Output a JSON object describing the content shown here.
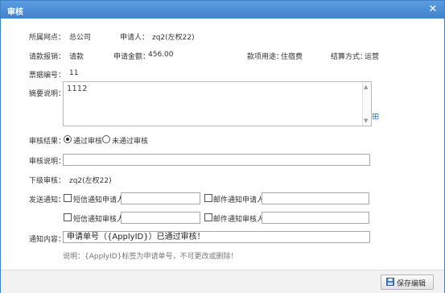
{
  "dialog": {
    "title": "审核",
    "close_glyph": "✕"
  },
  "info": {
    "branch_label": "所属网点：",
    "branch_value": "总公司",
    "applicant_label": "申请人：",
    "applicant_value": "zq2(左权22)",
    "type_label": "请款报销：",
    "type_value": "请款",
    "amount_label": "申请金额：",
    "amount_value": "456.00",
    "purpose_label": "款项用途：",
    "purpose_value": "住宿费",
    "settle_label": "结算方式：",
    "settle_value": "运营",
    "voucher_label": "票据编号：",
    "voucher_value": "11"
  },
  "summary": {
    "label": "摘要说明：",
    "value": "1112"
  },
  "result": {
    "label": "审核结果：",
    "options": [
      {
        "label": "通过审核",
        "checked": true
      },
      {
        "label": "未通过审核",
        "checked": false
      }
    ]
  },
  "remark": {
    "label": "审核说明：",
    "value": ""
  },
  "next_reviewer": {
    "label": "下级审核：",
    "value": "zq2(左权22)"
  },
  "notify": {
    "label": "发送通知：",
    "sms_applicant": "短信通知申请人",
    "email_applicant": "邮件通知申请人",
    "sms_reviewer": "短信通知审核人",
    "email_reviewer": "邮件通知审核人"
  },
  "notify_content": {
    "label": "通知内容：",
    "value": "申请单号（{ApplyID}）已通过审核！",
    "note": "说明：{ApplyID}标签为申请单号，不可更改或删除！"
  },
  "footer": {
    "save_label": "保存编辑"
  },
  "icons": {
    "plus": "plus-icon",
    "save": "save-icon",
    "close": "close-icon"
  },
  "colors": {
    "titlebar": "#4a8fd8",
    "accent": "#3a7fd0"
  }
}
